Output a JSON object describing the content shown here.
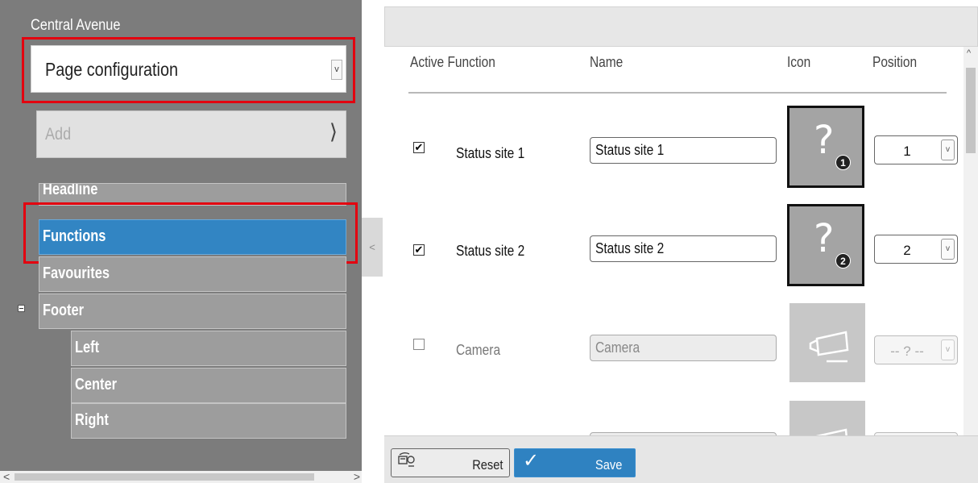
{
  "sidebar": {
    "site_title": "Central Avenue",
    "page_select": {
      "value": "Page configuration",
      "arrow": "v"
    },
    "add": {
      "label": "Add",
      "chevron": "⟩"
    },
    "items": [
      {
        "label": "Headline"
      },
      {
        "label": "Functions"
      },
      {
        "label": "Favourites"
      },
      {
        "label": "Footer"
      },
      {
        "label": "Left"
      },
      {
        "label": "Center"
      },
      {
        "label": "Right"
      }
    ],
    "active_item": "Functions",
    "scroll": {
      "left": "<",
      "right": ">"
    }
  },
  "collapse_handle": "<",
  "table": {
    "headers": {
      "active_function": "Active Function",
      "name": "Name",
      "icon": "Icon",
      "position": "Position"
    },
    "rows": [
      {
        "active": true,
        "function": "Status site 1",
        "name": "Status site 1",
        "icon": "question-mark-icon",
        "badge": "1",
        "position": "1"
      },
      {
        "active": true,
        "function": "Status site 2",
        "name": "Status site 2",
        "icon": "question-mark-icon",
        "badge": "2",
        "position": "2"
      },
      {
        "active": false,
        "function": "Camera",
        "name": "Camera",
        "icon": "camera-icon",
        "position": "-- ? --"
      }
    ],
    "scroll_up": "^",
    "check": "✔"
  },
  "toolbar": {
    "reset_label": "Reset",
    "save_label": "Save",
    "save_check": "✓"
  },
  "colors": {
    "sidebar_bg": "#7c7c7c",
    "active_item": "#3285c3",
    "highlight_box": "#e3000f",
    "save_button": "#2f82c1"
  }
}
